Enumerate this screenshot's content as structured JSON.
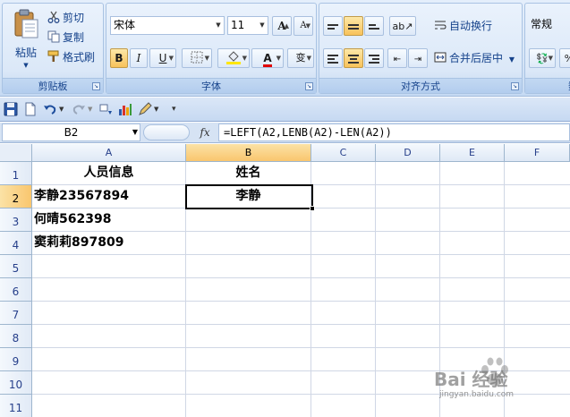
{
  "ribbon": {
    "clipboard": {
      "paste_label": "粘贴",
      "cut_label": "剪切",
      "copy_label": "复制",
      "format_painter_label": "格式刷",
      "group_label": "剪贴板"
    },
    "font": {
      "font_name": "宋体",
      "font_size": "11",
      "grow_label": "A",
      "shrink_label": "A",
      "bold_label": "B",
      "italic_label": "I",
      "underline_label": "U",
      "font_color_label": "A",
      "phonetic_label": "变",
      "group_label": "字体"
    },
    "alignment": {
      "wrap_text_label": "自动换行",
      "merge_center_label": "合并后居中",
      "group_label": "对齐方式"
    },
    "number": {
      "format_value": "常规",
      "group_label": "数"
    }
  },
  "formula_bar": {
    "name_box": "B2",
    "fx_label": "fx",
    "formula": "=LEFT(A2,LENB(A2)-LEN(A2))"
  },
  "sheet": {
    "columns": [
      "A",
      "B",
      "C",
      "D",
      "E",
      "F"
    ],
    "rows": [
      "1",
      "2",
      "3",
      "4",
      "5",
      "6",
      "7",
      "8",
      "9",
      "10",
      "11"
    ],
    "selected_cell": "B2",
    "cells": {
      "A1": "人员信息",
      "B1": "姓名",
      "A2": "李静23567894",
      "B2": "李静",
      "A3": "何晴562398",
      "A4": "窦莉莉897809"
    }
  },
  "watermark": {
    "text": "Bai 经验",
    "url_text": "jingyan.baidu.com"
  },
  "colors": {
    "ribbon_bg": "#d6e5f7",
    "group_label": "#15428b",
    "selected_header": "#f9c66e",
    "grid_line": "#d0d7e5"
  }
}
